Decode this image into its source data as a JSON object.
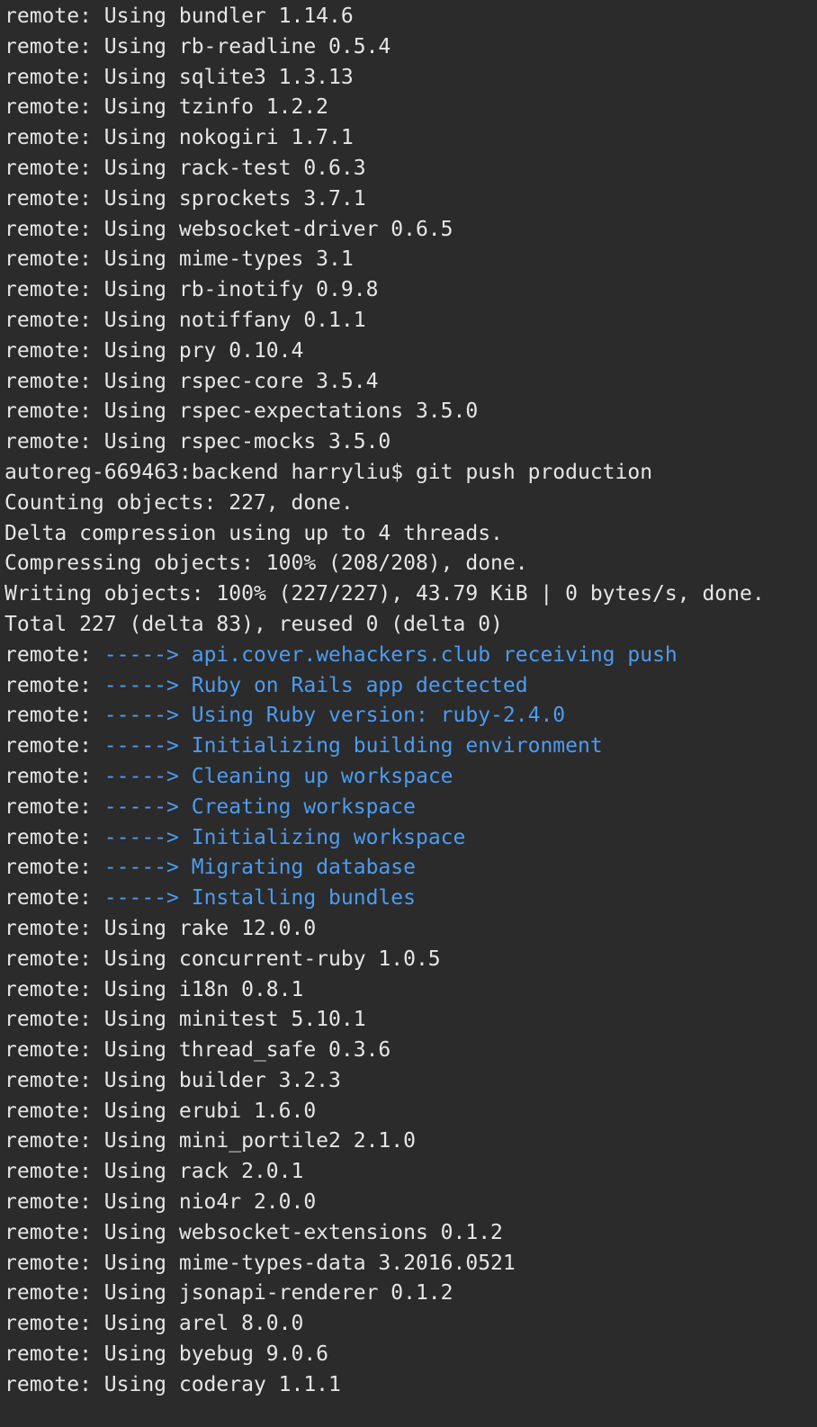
{
  "colors": {
    "background": "#2b2b2b",
    "text": "#e6e6e6",
    "arrow": "#4d9bf0"
  },
  "lines": [
    {
      "prefix": "remote: ",
      "text": "Using bundler 1.14.6"
    },
    {
      "prefix": "remote: ",
      "text": "Using rb-readline 0.5.4"
    },
    {
      "prefix": "remote: ",
      "text": "Using sqlite3 1.3.13"
    },
    {
      "prefix": "remote: ",
      "text": "Using tzinfo 1.2.2"
    },
    {
      "prefix": "remote: ",
      "text": "Using nokogiri 1.7.1"
    },
    {
      "prefix": "remote: ",
      "text": "Using rack-test 0.6.3"
    },
    {
      "prefix": "remote: ",
      "text": "Using sprockets 3.7.1"
    },
    {
      "prefix": "remote: ",
      "text": "Using websocket-driver 0.6.5"
    },
    {
      "prefix": "remote: ",
      "text": "Using mime-types 3.1"
    },
    {
      "prefix": "remote: ",
      "text": "Using rb-inotify 0.9.8"
    },
    {
      "prefix": "remote: ",
      "text": "Using notiffany 0.1.1"
    },
    {
      "prefix": "remote: ",
      "text": "Using pry 0.10.4"
    },
    {
      "prefix": "remote: ",
      "text": "Using rspec-core 3.5.4"
    },
    {
      "prefix": "remote: ",
      "text": "Using rspec-expectations 3.5.0"
    },
    {
      "prefix": "remote: ",
      "text": "Using rspec-mocks 3.5.0"
    },
    {
      "prefix": "",
      "text": "autoreg-669463:backend harryliu$ git push production"
    },
    {
      "prefix": "",
      "text": "Counting objects: 227, done."
    },
    {
      "prefix": "",
      "text": "Delta compression using up to 4 threads."
    },
    {
      "prefix": "",
      "text": "Compressing objects: 100% (208/208), done."
    },
    {
      "prefix": "",
      "text": "Writing objects: 100% (227/227), 43.79 KiB | 0 bytes/s, done."
    },
    {
      "prefix": "",
      "text": "Total 227 (delta 83), reused 0 (delta 0)"
    },
    {
      "prefix": "remote: ",
      "arrow": "-----> ",
      "text": "api.cover.wehackers.club receiving push"
    },
    {
      "prefix": "remote: ",
      "arrow": "-----> ",
      "text": "Ruby on Rails app dectected"
    },
    {
      "prefix": "remote: ",
      "arrow": "-----> ",
      "text": "Using Ruby version: ruby-2.4.0"
    },
    {
      "prefix": "remote: ",
      "arrow": "-----> ",
      "text": "Initializing building environment"
    },
    {
      "prefix": "remote: ",
      "arrow": "-----> ",
      "text": "Cleaning up workspace"
    },
    {
      "prefix": "remote: ",
      "arrow": "-----> ",
      "text": "Creating workspace"
    },
    {
      "prefix": "remote: ",
      "arrow": "-----> ",
      "text": "Initializing workspace"
    },
    {
      "prefix": "remote: ",
      "arrow": "-----> ",
      "text": "Migrating database"
    },
    {
      "prefix": "remote: ",
      "arrow": "-----> ",
      "text": "Installing bundles"
    },
    {
      "prefix": "remote: ",
      "text": "Using rake 12.0.0"
    },
    {
      "prefix": "remote: ",
      "text": "Using concurrent-ruby 1.0.5"
    },
    {
      "prefix": "remote: ",
      "text": "Using i18n 0.8.1"
    },
    {
      "prefix": "remote: ",
      "text": "Using minitest 5.10.1"
    },
    {
      "prefix": "remote: ",
      "text": "Using thread_safe 0.3.6"
    },
    {
      "prefix": "remote: ",
      "text": "Using builder 3.2.3"
    },
    {
      "prefix": "remote: ",
      "text": "Using erubi 1.6.0"
    },
    {
      "prefix": "remote: ",
      "text": "Using mini_portile2 2.1.0"
    },
    {
      "prefix": "remote: ",
      "text": "Using rack 2.0.1"
    },
    {
      "prefix": "remote: ",
      "text": "Using nio4r 2.0.0"
    },
    {
      "prefix": "remote: ",
      "text": "Using websocket-extensions 0.1.2"
    },
    {
      "prefix": "remote: ",
      "text": "Using mime-types-data 3.2016.0521"
    },
    {
      "prefix": "remote: ",
      "text": "Using jsonapi-renderer 0.1.2"
    },
    {
      "prefix": "remote: ",
      "text": "Using arel 8.0.0"
    },
    {
      "prefix": "remote: ",
      "text": "Using byebug 9.0.6"
    },
    {
      "prefix": "remote: ",
      "text": "Using coderay 1.1.1"
    }
  ]
}
